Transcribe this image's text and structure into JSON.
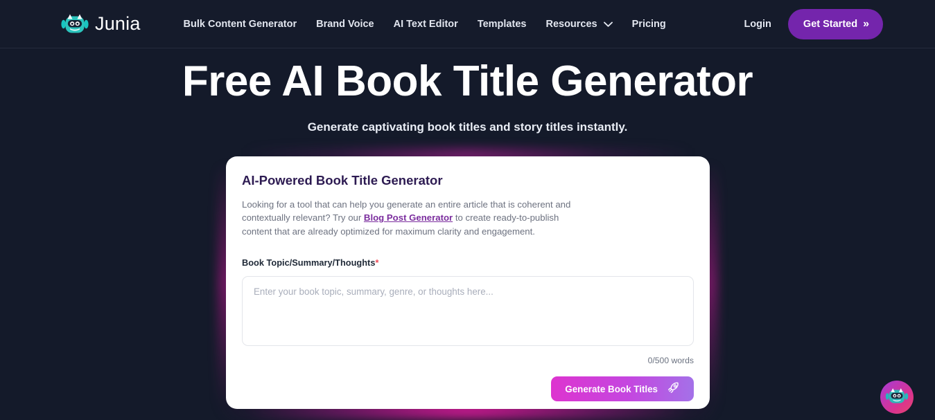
{
  "header": {
    "logo_text": "Junia",
    "logo_icon": "junia-robot-mascot-icon",
    "nav_items": [
      {
        "label": "Bulk Content Generator",
        "has_chevron": false
      },
      {
        "label": "Brand Voice",
        "has_chevron": false
      },
      {
        "label": "AI Text Editor",
        "has_chevron": false
      },
      {
        "label": "Templates",
        "has_chevron": false
      },
      {
        "label": "Resources",
        "has_chevron": true
      },
      {
        "label": "Pricing",
        "has_chevron": false
      }
    ],
    "login_label": "Login",
    "cta_label": "Get Started",
    "cta_icon": "double-chevron-right-icon",
    "cta_color": "#7425ac"
  },
  "hero": {
    "title": "Free AI Book Title Generator",
    "subtitle": "Generate captivating book titles and story titles instantly."
  },
  "card": {
    "title": "AI-Powered Book Title Generator",
    "description_part1": "Looking for a tool that can help you generate an entire article that is coherent and contextually relevant? Try our ",
    "description_link": "Blog Post Generator",
    "description_part2": " to create ready-to-publish content that are already optimized for maximum clarity and engagement.",
    "field_label": "Book Topic/Summary/Thoughts",
    "required_marker": "*",
    "textarea_value": "",
    "textarea_placeholder": "Enter your book topic, summary, genre, or thoughts here...",
    "word_count": "0/500 words",
    "submit_label": "Generate Book Titles",
    "submit_icon": "rocket-icon",
    "glow_color": "#d61a96",
    "link_color": "#7b2d9e"
  },
  "chat": {
    "icon": "junia-robot-chat-icon",
    "accent_color": "#d9338f"
  },
  "theme": {
    "page_background": "#141a2a",
    "header_background": "#151b2b",
    "card_background": "#ffffff"
  }
}
